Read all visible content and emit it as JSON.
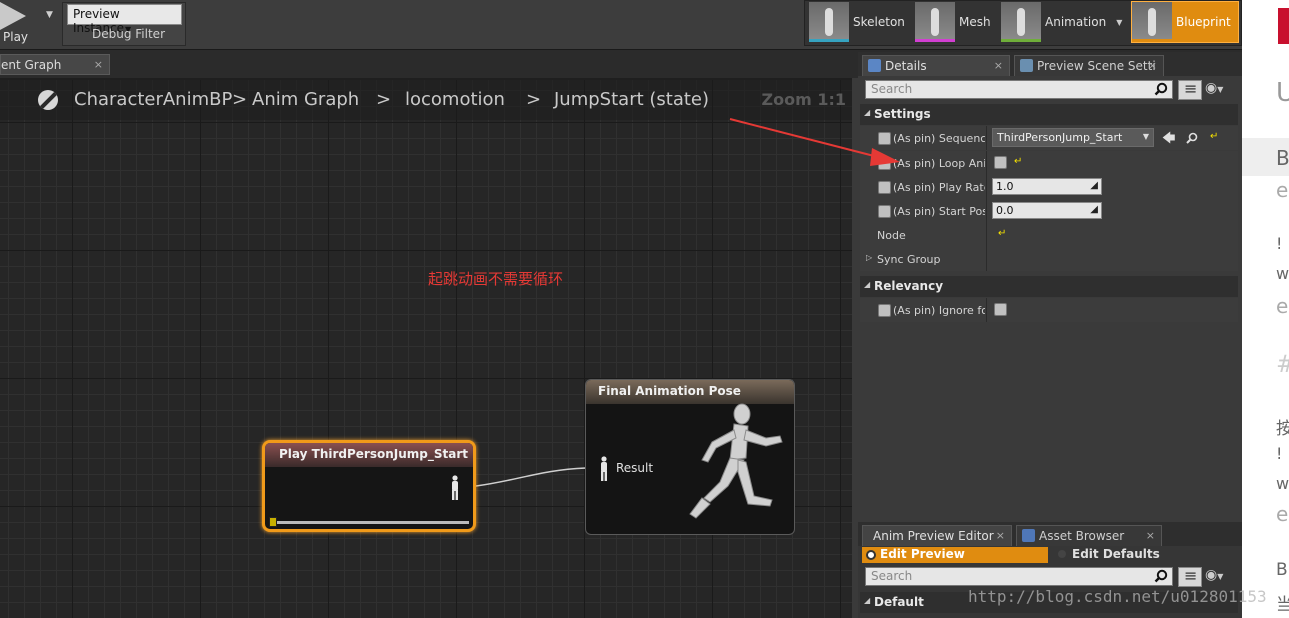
{
  "toolbar": {
    "play_label": "Play",
    "preview_instance": "Preview Instance",
    "debug_filter": "Debug Filter",
    "modes": [
      "Skeleton",
      "Mesh",
      "Animation",
      "Blueprint"
    ]
  },
  "graph_tab": {
    "label": "ent Graph",
    "close": "×"
  },
  "breadcrumb": {
    "items": [
      "CharacterAnimBP",
      "Anim Graph",
      "locomotion",
      "JumpStart (state)"
    ],
    "separators": [
      ">",
      ">",
      ">"
    ],
    "zoom": "Zoom 1:1"
  },
  "annotation": "起跳动画不需要循环",
  "nodes": {
    "play": {
      "title": "Play ThirdPersonJump_Start",
      "progress": 0.0
    },
    "final": {
      "title": "Final Animation Pose",
      "result_label": "Result"
    }
  },
  "details": {
    "tabs": [
      {
        "label": "Details",
        "close": "×"
      },
      {
        "label": "Preview Scene Setti",
        "close": "×"
      }
    ],
    "search_placeholder": "Search",
    "categories": {
      "settings": "Settings",
      "sync_group": "Sync Group",
      "relevancy": "Relevancy"
    },
    "props": {
      "sequence": {
        "label": "(As pin) Sequence",
        "value": "ThirdPersonJump_Start"
      },
      "loop": {
        "label": "(As pin) Loop Anir",
        "checked": false
      },
      "play_rate": {
        "label": "(As pin) Play Rate",
        "value": "1.0"
      },
      "start_pos": {
        "label": "(As pin) Start Pos",
        "value": "0.0"
      },
      "node": {
        "label": "Node"
      },
      "ignore_for": {
        "label": "(As pin) Ignore for",
        "checked": false
      }
    }
  },
  "lower_panel": {
    "tabs": [
      {
        "label": "Anim Preview Editor",
        "close": "×"
      },
      {
        "label": "Asset Browser",
        "close": "×"
      }
    ],
    "edit_preview": "Edit Preview",
    "edit_defaults": "Edit Defaults",
    "search_placeholder": "Search",
    "category_default": "Default"
  },
  "watermark": "http://blog.csdn.net/u012801153",
  "right_strip": {
    "letters": [
      "U",
      "B",
      "e",
      "!",
      "w",
      "e",
      "#",
      "按",
      "!",
      "w",
      "e",
      "B",
      "当"
    ]
  },
  "colors": {
    "accent": "#e08c10",
    "annotation": "#e53935"
  }
}
